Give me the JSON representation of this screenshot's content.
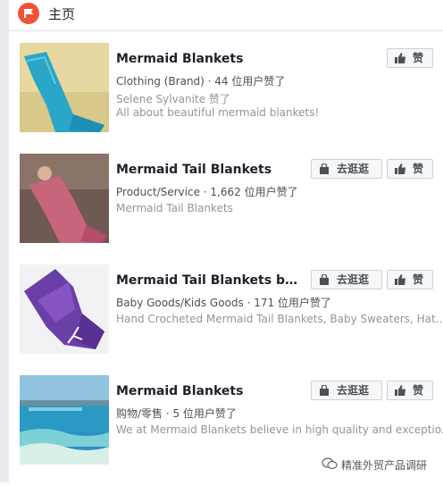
{
  "header": {
    "title": "主页",
    "icon": "flag-icon"
  },
  "cards": [
    {
      "name": "Mermaid Blankets",
      "category": "Clothing (Brand) · 44 位用户赞了",
      "liker": "Selene Sylvanite 赞了",
      "desc": "All about beautiful mermaid blankets!",
      "shop_label": "",
      "like_label": "赞"
    },
    {
      "name": "Mermaid Tail Blankets",
      "category": "Product/Service · 1,662 位用户赞了",
      "desc": "Mermaid Tail Blankets",
      "shop_label": "去逛逛",
      "like_label": "赞"
    },
    {
      "name": "Mermaid Tail Blankets by B...",
      "category": "Baby Goods/Kids Goods · 171 位用户赞了",
      "desc": "Hand Crocheted Mermaid Tail Blankets, Baby Sweaters, Hat...",
      "shop_label": "去逛逛",
      "like_label": "赞"
    },
    {
      "name": "Mermaid Blankets",
      "category": "购物/零售 · 5 位用户赞了",
      "desc": "We at Mermaid Blankets believe in high quality and exceptio...",
      "shop_label": "去逛逛",
      "like_label": "赞"
    }
  ],
  "watermark": {
    "text": "精准外贸产品调研"
  },
  "colors": {
    "accent": "#f0513a",
    "border": "#dddfe2",
    "muted": "#90949c"
  }
}
